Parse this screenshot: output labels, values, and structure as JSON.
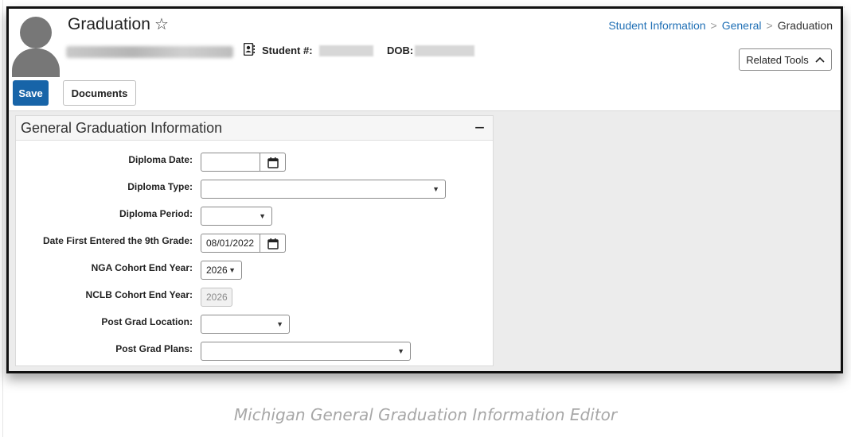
{
  "header": {
    "title": "Graduation",
    "student_label": "Student #:",
    "dob_label": "DOB:"
  },
  "breadcrumb": {
    "items": [
      "Student Information",
      "General",
      "Graduation"
    ]
  },
  "related_tools": {
    "label": "Related Tools"
  },
  "toolbar": {
    "save_label": "Save",
    "documents_label": "Documents"
  },
  "panel": {
    "title": "General Graduation Information",
    "fields": [
      {
        "label": "Diploma Date:",
        "type": "date",
        "value": ""
      },
      {
        "label": "Diploma Type:",
        "type": "select",
        "value": ""
      },
      {
        "label": "Diploma Period:",
        "type": "select",
        "value": ""
      },
      {
        "label": "Date First Entered the 9th Grade:",
        "type": "date",
        "value": "08/01/2022"
      },
      {
        "label": "NGA Cohort End Year:",
        "type": "select",
        "value": "2026"
      },
      {
        "label": "NCLB Cohort End Year:",
        "type": "text-disabled",
        "value": "2026"
      },
      {
        "label": "Post Grad Location:",
        "type": "select",
        "value": ""
      },
      {
        "label": "Post Grad Plans:",
        "type": "select",
        "value": ""
      }
    ]
  },
  "caption": "Michigan General Graduation Information Editor",
  "colors": {
    "accent": "#1764a8",
    "link": "#1f6fb5"
  },
  "icons": [
    "star-icon",
    "contact-card-icon",
    "chevron-up-icon",
    "calendar-icon",
    "caret-down-icon",
    "collapse-icon"
  ]
}
